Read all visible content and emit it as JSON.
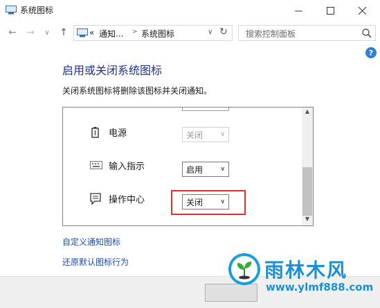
{
  "window": {
    "title": "系统图标"
  },
  "address": {
    "breadcrumb_prefix": "«",
    "crumb1": "通知...",
    "crumb2": "系统图标"
  },
  "search": {
    "placeholder": "搜索控制面板"
  },
  "help": {
    "glyph": "?"
  },
  "page": {
    "title": "启用或关闭系统图标",
    "description": "关闭系统图标将删除该图标并关闭通知。"
  },
  "rows": [
    {
      "label": "电源",
      "icon": "power-icon",
      "value": "关闭",
      "enabled": false
    },
    {
      "label": "输入指示",
      "icon": "keyboard-icon",
      "value": "启用",
      "enabled": true
    },
    {
      "label": "操作中心",
      "icon": "action-center-icon",
      "value": "关闭",
      "enabled": true
    }
  ],
  "links": {
    "customize": "自定义通知图标",
    "restore": "还原默认图标行为"
  },
  "watermark": {
    "name": "雨林木风",
    "url": "www.ylmf888.com"
  },
  "colors": {
    "highlight": "#e02f2f",
    "link": "#1e4aa8",
    "title": "#1e3287"
  }
}
